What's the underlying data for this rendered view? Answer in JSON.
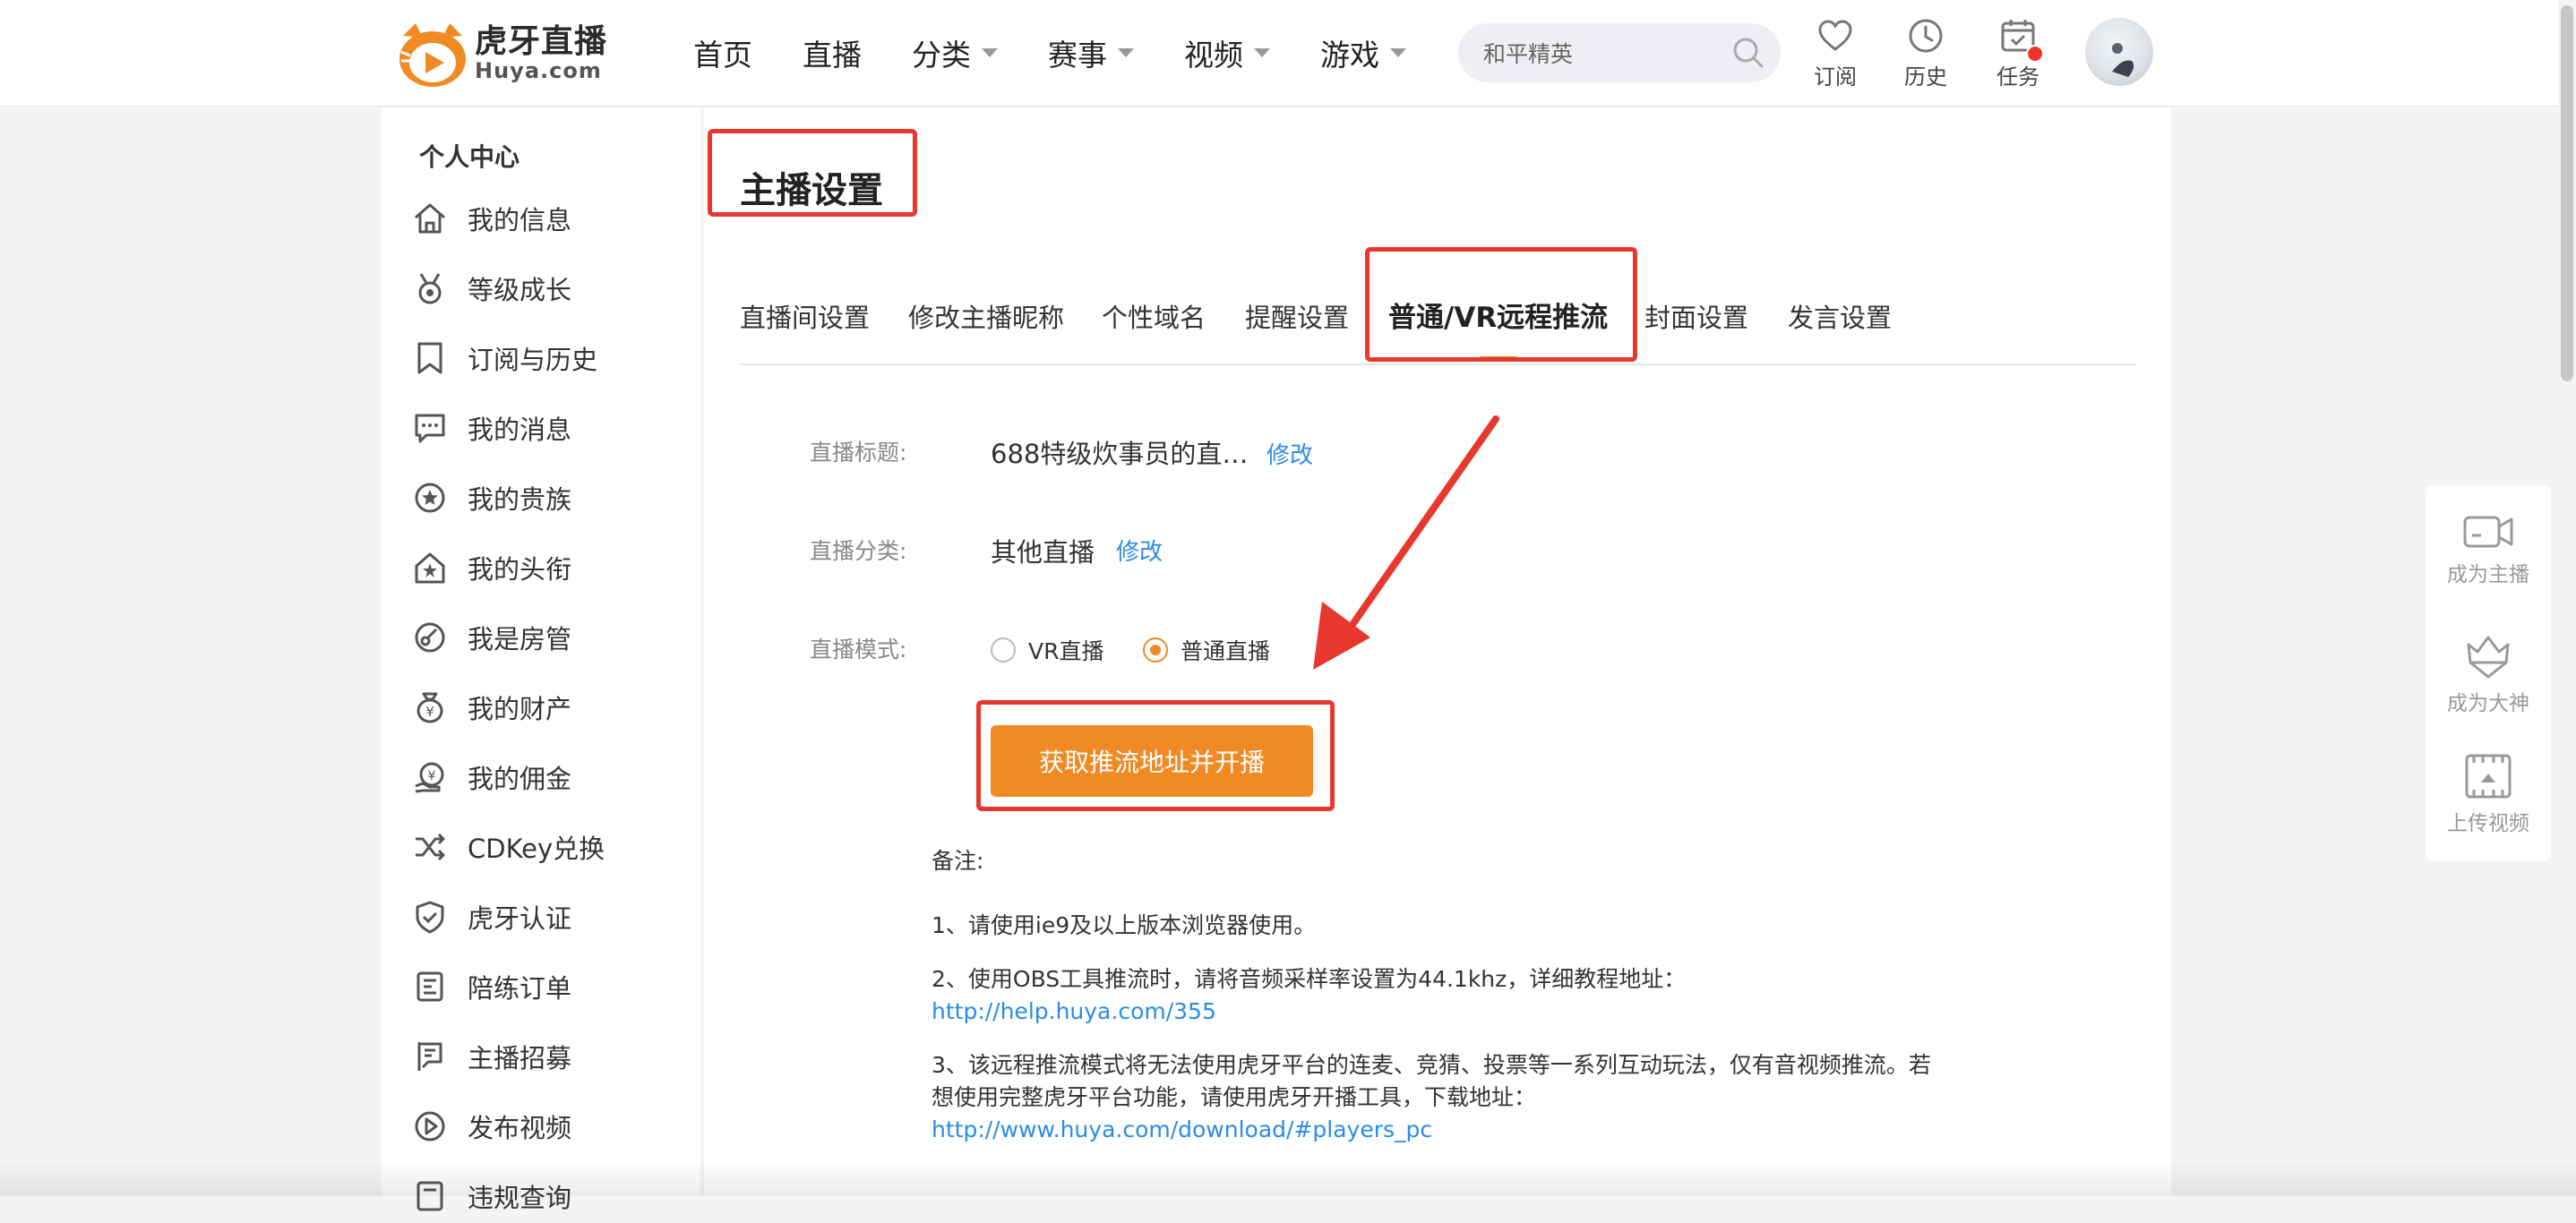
{
  "brand": {
    "name_cn": "虎牙直播",
    "name_en": "Huya.com",
    "color": "#f08a24"
  },
  "nav": {
    "items": [
      {
        "label": "首页",
        "has_caret": false
      },
      {
        "label": "直播",
        "has_caret": false
      },
      {
        "label": "分类",
        "has_caret": true
      },
      {
        "label": "赛事",
        "has_caret": true
      },
      {
        "label": "视频",
        "has_caret": true
      },
      {
        "label": "游戏",
        "has_caret": true
      }
    ],
    "search_placeholder": "和平精英"
  },
  "header_tools": [
    {
      "label": "订阅",
      "icon": "heart-icon"
    },
    {
      "label": "历史",
      "icon": "clock-icon"
    },
    {
      "label": "任务",
      "icon": "calendar-icon",
      "badge": true
    }
  ],
  "sidebar": {
    "title": "个人中心",
    "items": [
      {
        "label": "我的信息",
        "icon": "home-icon"
      },
      {
        "label": "等级成长",
        "icon": "medal-icon"
      },
      {
        "label": "订阅与历史",
        "icon": "bookmark-icon"
      },
      {
        "label": "我的消息",
        "icon": "message-icon"
      },
      {
        "label": "我的贵族",
        "icon": "star-badge-icon"
      },
      {
        "label": "我的头衔",
        "icon": "title-icon"
      },
      {
        "label": "我是房管",
        "icon": "manager-icon"
      },
      {
        "label": "我的财产",
        "icon": "money-bag-icon"
      },
      {
        "label": "我的佣金",
        "icon": "commission-icon"
      },
      {
        "label": "CDKey兑换",
        "icon": "shuffle-icon"
      },
      {
        "label": "虎牙认证",
        "icon": "shield-check-icon"
      },
      {
        "label": "陪练订单",
        "icon": "order-icon"
      },
      {
        "label": "主播招募",
        "icon": "recruit-flag-icon"
      },
      {
        "label": "发布视频",
        "icon": "play-circle-icon"
      },
      {
        "label": "违规查询",
        "icon": "query-icon"
      }
    ]
  },
  "main": {
    "page_title": "主播设置",
    "tabs": [
      {
        "label": "直播间设置",
        "active": false
      },
      {
        "label": "修改主播昵称",
        "active": false
      },
      {
        "label": "个性域名",
        "active": false
      },
      {
        "label": "提醒设置",
        "active": false
      },
      {
        "label": "普通/VR远程推流",
        "active": true
      },
      {
        "label": "封面设置",
        "active": false
      },
      {
        "label": "发言设置",
        "active": false
      }
    ],
    "form": {
      "title_label": "直播标题:",
      "title_value": "688特级炊事员的直…",
      "title_edit": "修改",
      "category_label": "直播分类:",
      "category_value": "其他直播",
      "category_edit": "修改",
      "mode_label": "直播模式:",
      "mode_options": [
        {
          "label": "VR直播",
          "checked": false
        },
        {
          "label": "普通直播",
          "checked": true
        }
      ],
      "submit_label": "获取推流地址并开播"
    },
    "notes": {
      "heading": "备注:",
      "line1": "1、请使用ie9及以上版本浏览器使用。",
      "line2_text": "2、使用OBS工具推流时，请将音频采样率设置为44.1khz，详细教程地址：",
      "line2_link": "http://help.huya.com/355",
      "line3_text": "3、该远程推流模式将无法使用虎牙平台的连麦、竞猜、投票等一系列互动玩法，仅有音视频推流。若想使用完整虎牙平台功能，请使用虎牙开播工具，下载地址：",
      "line3_link": "http://www.huya.com/download/#players_pc"
    }
  },
  "float_panel": [
    {
      "label": "成为主播",
      "icon": "camera-icon"
    },
    {
      "label": "成为大神",
      "icon": "crown-icon"
    },
    {
      "label": "上传视频",
      "icon": "upload-video-icon"
    }
  ],
  "annotation_color": "#e8382e"
}
